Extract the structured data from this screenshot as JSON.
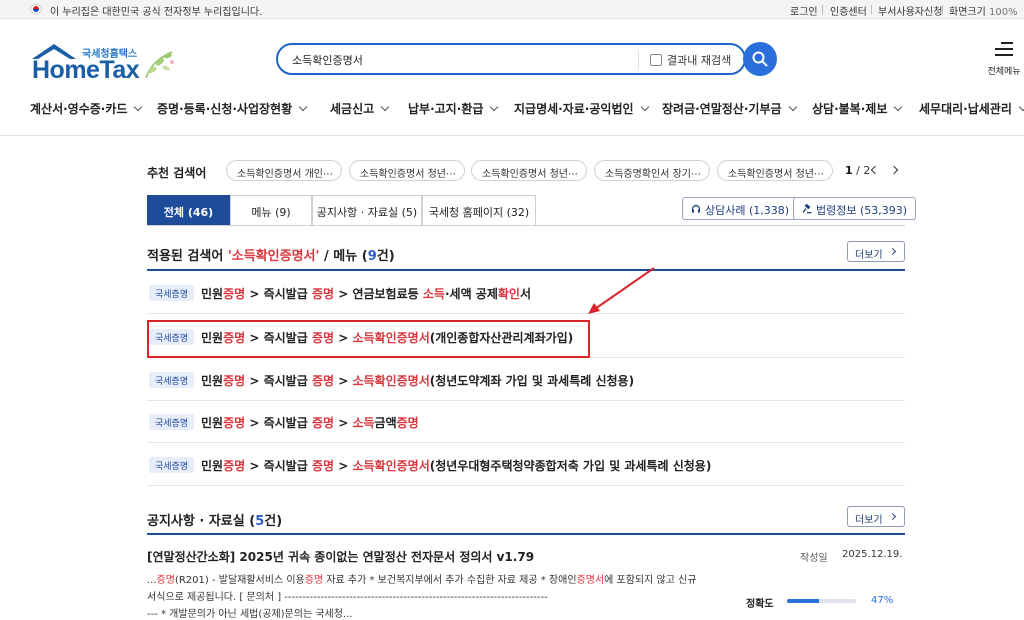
{
  "gov_bar": {
    "notice": "이 누리집은 대한민국 공식 전자정부 누리집입니다.",
    "links": [
      "로그인",
      "인증센터",
      "부서사용자신청"
    ],
    "zoom_label": "화면크기",
    "zoom_value": "100%"
  },
  "logo": {
    "small": "국세청홈택스",
    "main": "HomeTax"
  },
  "search": {
    "value": "소득확인증명서",
    "research_label": "결과내 재검색"
  },
  "menu_all": {
    "label": "전체메뉴"
  },
  "gnb": [
    "계산서·영수증·카드",
    "증명·등록·신청·사업장현황",
    "세금신고",
    "납부·고지·환급",
    "지급명세·자료·공익법인",
    "장려금·연말정산·기부금",
    "상담·불복·제보",
    "세무대리·납세관리"
  ],
  "recommended": {
    "label": "추천 검색어",
    "chips": [
      "소득확인증명서 개인⋯",
      "소득확인증명서 청년⋯",
      "소득확인증명서 청년⋯",
      "소득증명확인서 장기⋯",
      "소득확인증명서 청년⋯"
    ],
    "page_current": "1",
    "page_total": "/ 2"
  },
  "tabs": [
    "전체 (46)",
    "메뉴 (9)",
    "공지사항 · 자료실 (5)",
    "국세청 홈페이지 (32)"
  ],
  "side_buttons": [
    "상담사례 (1,338)",
    "법령정보 (53,393)"
  ],
  "menu_section": {
    "prefix": "적용된 검색어 ",
    "keyword": "'소득확인증명서'",
    "middle": " / 메뉴 (",
    "count": "9",
    "suffix": "건)",
    "more": "더보기"
  },
  "menu_rows": [
    {
      "badge": "국세증명",
      "p1": "민원",
      "p2": "증명",
      "p3": " > 즉시발급 ",
      "p4": "증명",
      "p5": " > 연금보험료등 ",
      "p6": "소득",
      "p7": "·세액 공제",
      "p8": "확인",
      "p9": "서"
    },
    {
      "badge": "국세증명",
      "p1": "민원",
      "p2": "증명",
      "p3": " > 즉시발급 ",
      "p4": "증명",
      "p5": " > ",
      "p6": "소득확인증명서",
      "p7": "(개인종합자산관리계좌가입)",
      "p8": "",
      "p9": ""
    },
    {
      "badge": "국세증명",
      "p1": "민원",
      "p2": "증명",
      "p3": " > 즉시발급 ",
      "p4": "증명",
      "p5": " > ",
      "p6": "소득확인증명서",
      "p7": "(청년도약계좌 가입 및 과세특례 신청용)",
      "p8": "",
      "p9": ""
    },
    {
      "badge": "국세증명",
      "p1": "민원",
      "p2": "증명",
      "p3": " > 즉시발급 ",
      "p4": "증명",
      "p5": " > ",
      "p6": "소득",
      "p7": "금액",
      "p8": "증명",
      "p9": ""
    },
    {
      "badge": "국세증명",
      "p1": "민원",
      "p2": "증명",
      "p3": " > 즉시발급 ",
      "p4": "증명",
      "p5": " > ",
      "p6": "소득확인증명서",
      "p7": "(청년우대형주택청약종합저축 가입 및 과세특례 신청용)",
      "p8": "",
      "p9": ""
    }
  ],
  "notice_section": {
    "prefix": "공지사항 · 자료실 (",
    "count": "5",
    "suffix": "건)",
    "more": "더보기"
  },
  "notice": {
    "title": "[연말정산간소화] 2025년 귀속 종이없는 연말정산 전자문서 정의서 v1.79",
    "date_label": "작성일",
    "date": "2025.12.19.",
    "line1_a": "...",
    "line1_b": "증명",
    "line1_c": "(R201) - 발달재활서비스 이용",
    "line1_d": "증명",
    "line1_e": " 자료 추가 * 보건복지부에서 추가 수집한 자료 제공 * 장애인",
    "line1_f": "증명서",
    "line1_g": "에 포함되지 않고 신규",
    "line2": "서식으로 제공됩니다. [ 문의처 ] -------------------------------------------------------------------------",
    "line3": "--- * 개발문의가 아닌 세법(공제)문의는 국세청...",
    "accuracy_label": "정확도",
    "accuracy_value": "47%",
    "accuracy": 0.47
  }
}
